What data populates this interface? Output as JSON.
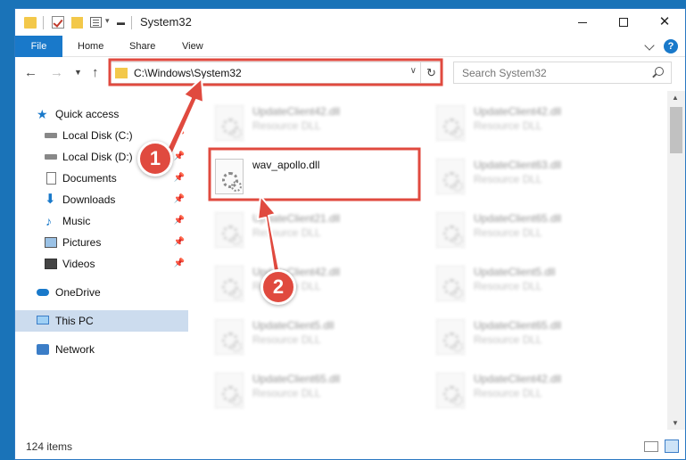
{
  "window": {
    "title": "System32"
  },
  "ribbon": {
    "tabs": [
      "File",
      "Home",
      "Share",
      "View"
    ],
    "help": "?"
  },
  "address": {
    "path": "C:\\Windows\\System32"
  },
  "search": {
    "placeholder": "Search System32"
  },
  "nav_pane": {
    "items": [
      {
        "label": "Quick access",
        "icon": "star-icon"
      },
      {
        "label": "Local Disk (C:)",
        "icon": "drive-icon",
        "pinned": true
      },
      {
        "label": "Local Disk (D:)",
        "icon": "drive-icon",
        "pinned": true
      },
      {
        "label": "Documents",
        "icon": "documents-icon",
        "pinned": true
      },
      {
        "label": "Downloads",
        "icon": "download-icon",
        "pinned": true
      },
      {
        "label": "Music",
        "icon": "music-icon",
        "pinned": true
      },
      {
        "label": "Pictures",
        "icon": "pictures-icon",
        "pinned": true
      },
      {
        "label": "Videos",
        "icon": "videos-icon",
        "pinned": true
      },
      {
        "label": "OneDrive",
        "icon": "cloud-icon"
      },
      {
        "label": "This PC",
        "icon": "computer-icon",
        "selected": true
      },
      {
        "label": "Network",
        "icon": "network-icon"
      }
    ]
  },
  "files": {
    "type_label": "Resource DLL",
    "highlighted": "wav_apollo.dll",
    "left_col": [
      "UpdateClient42.dll",
      "wav_apollo.dll",
      "UpdateClient21.dll",
      "UpdateClient42.dll",
      "UpdateClient5.dll",
      "UpdateClient65.dll"
    ],
    "right_col": [
      "UpdateClient42.dll",
      "UpdateClient63.dll",
      "UpdateClient65.dll",
      "UpdateClient5.dll",
      "UpdateClient65.dll",
      "UpdateClient42.dll"
    ]
  },
  "status": {
    "count": "124 items"
  },
  "annotations": {
    "step1": "1",
    "step2": "2",
    "highlight_color": "#e04a3f"
  }
}
